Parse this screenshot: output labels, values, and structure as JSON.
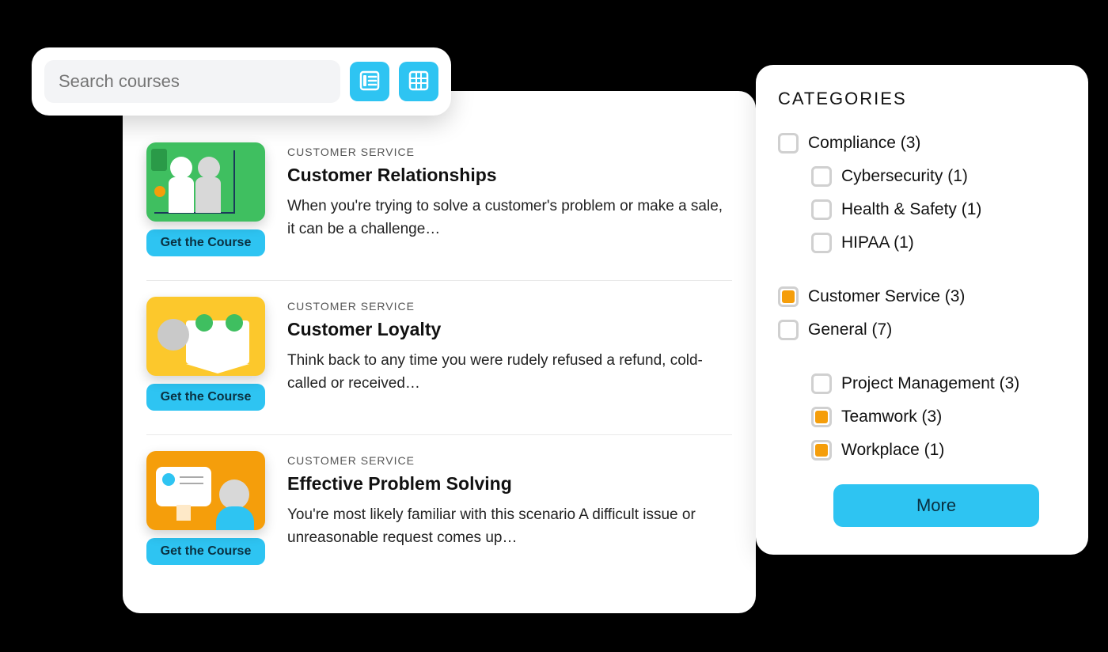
{
  "search": {
    "placeholder": "Search courses"
  },
  "buttons": {
    "get_course": "Get the Course",
    "more": "More"
  },
  "courses": [
    {
      "category": "CUSTOMER SERVICE",
      "title": "Customer Relationships",
      "desc": "When you're trying to solve a customer's problem or make a sale, it can be a challenge…"
    },
    {
      "category": "CUSTOMER SERVICE",
      "title": "Customer Loyalty",
      "desc": "Think back to any time you were rudely refused a refund, cold-called or received…"
    },
    {
      "category": "CUSTOMER SERVICE",
      "title": "Effective Problem Solving",
      "desc": "You're most likely familiar with this scenario A difficult issue or unreasonable request comes up…"
    }
  ],
  "categories": {
    "title": "CATEGORIES",
    "items": [
      {
        "label": "Compliance (3)",
        "checked": false,
        "child": false
      },
      {
        "label": "Cybersecurity (1)",
        "checked": false,
        "child": true
      },
      {
        "label": "Health & Safety (1)",
        "checked": false,
        "child": true
      },
      {
        "label": "HIPAA (1)",
        "checked": false,
        "child": true
      },
      {
        "label": "Customer Service (3)",
        "checked": true,
        "child": false,
        "gapBefore": true
      },
      {
        "label": "General (7)",
        "checked": false,
        "child": false
      },
      {
        "label": "Project Management (3)",
        "checked": false,
        "child": true,
        "gapBefore": true
      },
      {
        "label": "Teamwork (3)",
        "checked": true,
        "child": true
      },
      {
        "label": "Workplace (1)",
        "checked": true,
        "child": true
      }
    ]
  }
}
